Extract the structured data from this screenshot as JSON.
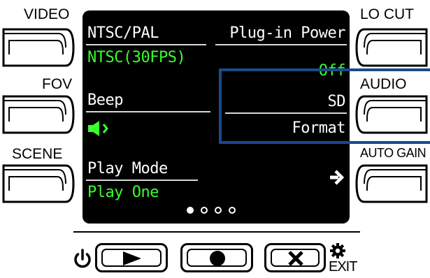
{
  "left_buttons": [
    {
      "label": "VIDEO"
    },
    {
      "label": "FOV"
    },
    {
      "label": "SCENE"
    }
  ],
  "right_buttons": [
    {
      "label": "LO CUT"
    },
    {
      "label": "AUDIO"
    },
    {
      "label": "AUTO GAIN"
    }
  ],
  "screen": {
    "ntsc_pal": {
      "title": "NTSC/PAL",
      "value": "NTSC(30FPS)"
    },
    "plugin_power": {
      "title": "Plug-in Power",
      "value": "Off"
    },
    "beep": {
      "title": "Beep",
      "value_icon": "speaker-on-icon"
    },
    "sd": {
      "title": "SD",
      "value": "Format"
    },
    "play_mode": {
      "title": "Play Mode",
      "value": "Play One"
    },
    "next_icon": "arrow-right-icon",
    "page_indicator": {
      "total": 4,
      "current": 1
    }
  },
  "bottom_buttons": {
    "power_icon": "power-icon",
    "play_icon": "play-icon",
    "record_icon": "record-icon",
    "cancel_icon": "x-icon",
    "settings_icon": "gear-icon",
    "exit_label": "EXIT"
  },
  "colors": {
    "value_green": "#39ff2c",
    "highlight_blue": "#1a4a8c",
    "screen_bg": "#000000"
  }
}
